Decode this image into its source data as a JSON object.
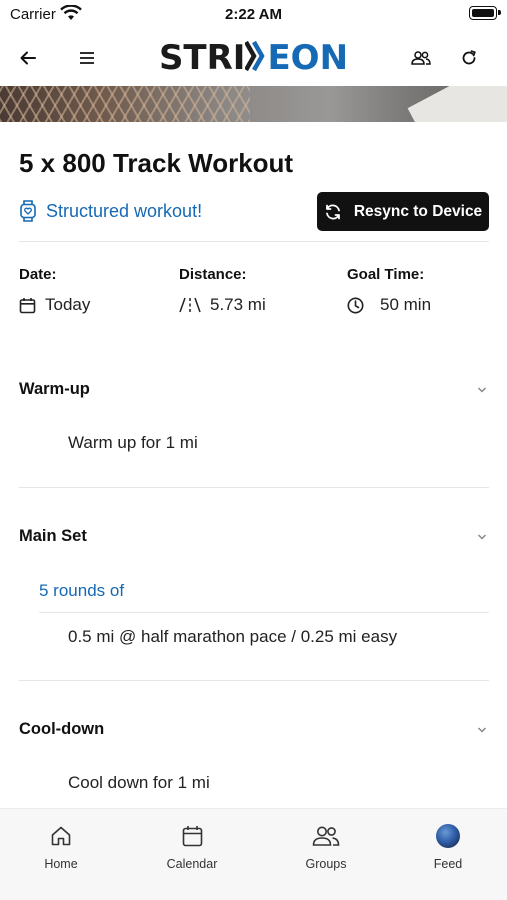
{
  "status_bar": {
    "carrier": "Carrier",
    "time": "2:22 AM"
  },
  "header": {
    "logo_part1": "STRI",
    "logo_part2": "EON",
    "back_icon": "arrow-left-icon",
    "menu_icon": "hamburger-menu-icon",
    "groups_icon": "people-icon",
    "refresh_icon": "refresh-icon"
  },
  "workout": {
    "title": "5 x 800 Track Workout",
    "structured_label": "Structured workout!",
    "resync_label": "Resync to Device",
    "date_label": "Date:",
    "date_value": "Today",
    "distance_label": "Distance:",
    "distance_value": "5.73 mi",
    "goal_label": "Goal Time:",
    "goal_value": "50 min"
  },
  "sections": {
    "warmup": {
      "title": "Warm-up",
      "step": "Warm up for 1 mi"
    },
    "main": {
      "title": "Main Set",
      "rounds": "5 rounds of",
      "step": "0.5 mi @ half marathon pace / 0.25 mi easy"
    },
    "cooldown": {
      "title": "Cool-down",
      "step": "Cool down for 1 mi"
    }
  },
  "bottom_nav": {
    "items": [
      {
        "label": "Home",
        "icon": "home-icon"
      },
      {
        "label": "Calendar",
        "icon": "calendar-icon"
      },
      {
        "label": "Groups",
        "icon": "people-icon"
      },
      {
        "label": "Feed",
        "icon": "avatar"
      }
    ]
  },
  "colors": {
    "brand_blue": "#1669b4",
    "button_dark": "#111111"
  }
}
